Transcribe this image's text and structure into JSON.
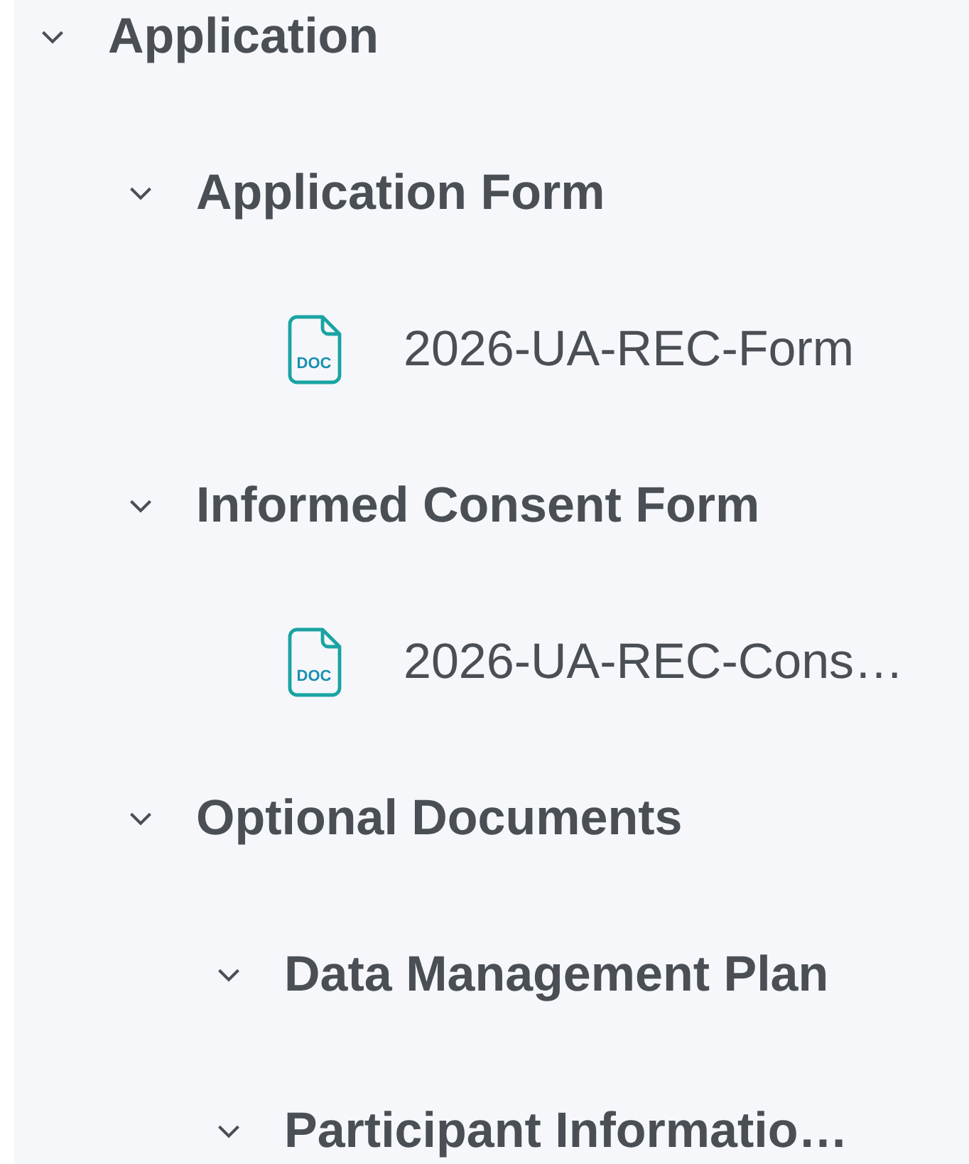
{
  "tree": [
    {
      "kind": "folder",
      "label": "Application",
      "expanded": true,
      "children": [
        {
          "kind": "folder",
          "label": "Application Form",
          "expanded": true,
          "children": [
            {
              "kind": "file",
              "label": "2026-UA-REC-Form",
              "badge": "DOC"
            }
          ]
        },
        {
          "kind": "folder",
          "label": "Informed Consent Form",
          "expanded": true,
          "children": [
            {
              "kind": "file",
              "label": "2026-UA-REC-Cons…",
              "badge": "DOC"
            }
          ]
        },
        {
          "kind": "folder",
          "label": "Optional Documents",
          "expanded": true,
          "children": [
            {
              "kind": "folder",
              "label": "Data Management Plan",
              "expanded": true
            },
            {
              "kind": "folder",
              "label": "Participant Informatio…",
              "expanded": true
            }
          ]
        }
      ]
    }
  ]
}
